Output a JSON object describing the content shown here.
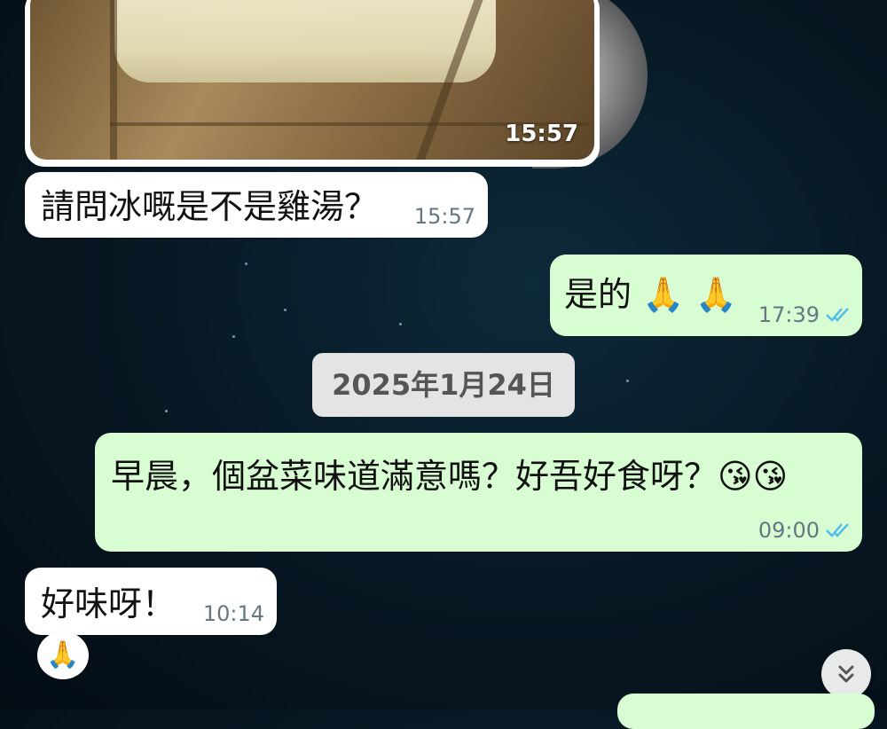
{
  "messages": {
    "image_time": "15:57",
    "m1_text": "請問冰嘅是不是雞湯？",
    "m1_time": "15:57",
    "m2_text": "是的 🙏 🙏",
    "m2_time": "17:39",
    "date_separator": "2025年1月24日",
    "m3_text": "早晨，個盆菜味道滿意嗎？好吾好食呀？😘😘",
    "m3_time": "09:00",
    "m4_text": "好味呀！",
    "m4_time": "10:14",
    "reaction_emoji": "🙏"
  },
  "icons": {
    "read_receipt": "double-check-icon",
    "scroll_down": "chevron-double-down-icon"
  },
  "colors": {
    "incoming_bubble": "#ffffff",
    "outgoing_bubble": "#d9fdd3",
    "read_tick": "#53bdeb",
    "timestamp": "#667781"
  }
}
